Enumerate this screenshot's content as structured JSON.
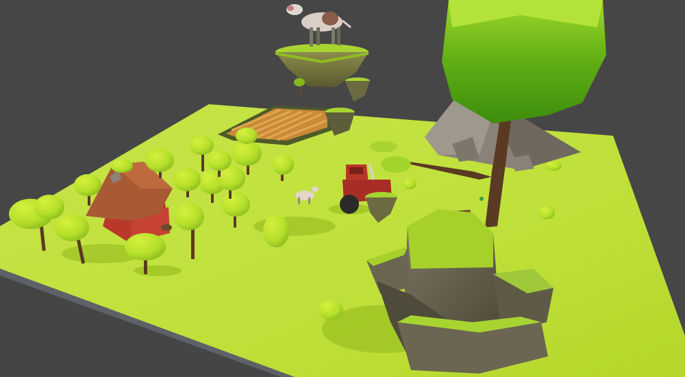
{
  "scene": {
    "description_visible_text": "",
    "background_color": "#444444",
    "ground_color": "#bfe03a",
    "ground_edge_color": "#5b5e64",
    "tree_foliage_color": "#b5e02a",
    "tree_trunk_color": "#5a3a22",
    "house_roof_color": "#a85a34",
    "house_wall_color": "#b8392a",
    "rock_color": "#6b6652",
    "mountain_color": "#8a8278",
    "tractor_color": "#b8352b",
    "crop_color": "#c98a3a"
  }
}
